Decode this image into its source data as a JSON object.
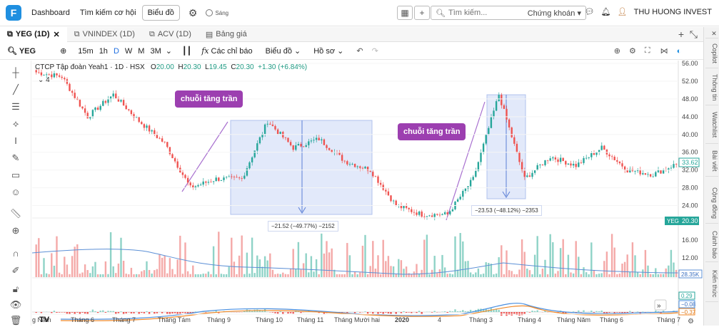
{
  "topbar": {
    "logo": "F",
    "nav": [
      "Dashboard",
      "Tìm kiếm cơ hội"
    ],
    "chart_button": "Biểu đồ",
    "toggle_label": "Sáng",
    "search_placeholder": "Tìm kiếm...",
    "search_scope": "Chứng khoán",
    "user": "THU HUONG INVEST"
  },
  "tabs": [
    {
      "label": "YEG (1D)",
      "active": true,
      "closable": true
    },
    {
      "label": "VNINDEX (1D)",
      "active": false
    },
    {
      "label": "ACV (1D)",
      "active": false
    },
    {
      "label": "Bảng giá",
      "active": false
    }
  ],
  "toolbar": {
    "symbol": "YEG",
    "intervals": [
      "15m",
      "1h",
      "D",
      "W",
      "M",
      "3M"
    ],
    "active_interval": "D",
    "indicators": "Các chỉ báo",
    "chart_type": "Biểu đồ",
    "profile": "Hồ sơ"
  },
  "right_tabs": [
    "Copilot",
    "Thông tin",
    "Watchlist",
    "Bài viết",
    "Cộng đồng",
    "Cảnh báo",
    "Kiến thức"
  ],
  "legend": {
    "name": "CTCP Tập đoàn Yeah1 · 1D · HSX",
    "o_label": "O",
    "o": "20.00",
    "h_label": "H",
    "h": "20.30",
    "l_label": "L",
    "l": "19.45",
    "c_label": "C",
    "c": "20.30",
    "change": "+1.30 (+6.84%)",
    "layers": "4"
  },
  "annotations": {
    "bubble1": "chuỗi tăng trần",
    "bubble2": "chuỗi tăng trần",
    "measure1": "−21.52 (−49.77%) −2152",
    "measure2": "−23.53 (−48.12%) −2353"
  },
  "price_axis": {
    "ticks": [
      "56.00",
      "52.00",
      "48.00",
      "44.00",
      "40.00",
      "36.00",
      "32.00",
      "28.00",
      "24.00"
    ],
    "current_marker": "33.62",
    "symbol_tag": "YEG",
    "symbol_tag_value": "20.30"
  },
  "volume_axis": {
    "ticks": [
      "16.00",
      "12.00"
    ],
    "marker": "28.35K"
  },
  "macd_axis": {
    "markers": [
      "0.29",
      "−0.08",
      "−0.37"
    ]
  },
  "time_axis": [
    "g Năm",
    "Tháng 6",
    "Tháng 7",
    "Tháng Tám",
    "Tháng 9",
    "Tháng 10",
    "Tháng 11",
    "Tháng Mười hai",
    "2020",
    "4",
    "Tháng 3",
    "Tháng 4",
    "Tháng Năm",
    "Tháng 6",
    "Tháng 7"
  ],
  "colors": {
    "up": "#26a69a",
    "down": "#ef5350",
    "accent": "#1f6fe0",
    "bubble": "#9c3fb0"
  },
  "chart_data": {
    "type": "candlestick",
    "symbol": "YEG",
    "ylim": [
      22,
      56
    ],
    "segments": [
      {
        "from": 54,
        "to": 53
      },
      {
        "from": 53,
        "to": 44
      },
      {
        "from": 44,
        "to": 49
      },
      {
        "from": 49,
        "to": 43
      },
      {
        "from": 43,
        "to": 38
      },
      {
        "from": 38,
        "to": 28
      },
      {
        "from": 28,
        "to": 30
      },
      {
        "from": 30,
        "to": 30
      },
      {
        "from": 30,
        "to": 43
      },
      {
        "from": 43,
        "to": 37
      },
      {
        "from": 37,
        "to": 39
      },
      {
        "from": 39,
        "to": 34
      },
      {
        "from": 34,
        "to": 32
      },
      {
        "from": 32,
        "to": 24
      },
      {
        "from": 24,
        "to": 22
      },
      {
        "from": 22,
        "to": 22
      },
      {
        "from": 22,
        "to": 30
      },
      {
        "from": 30,
        "to": 49
      },
      {
        "from": 49,
        "to": 30
      },
      {
        "from": 30,
        "to": 35
      },
      {
        "from": 35,
        "to": 33
      },
      {
        "from": 33,
        "to": 37
      },
      {
        "from": 37,
        "to": 32
      },
      {
        "from": 32,
        "to": 31
      },
      {
        "from": 31,
        "to": 33.6
      }
    ]
  }
}
